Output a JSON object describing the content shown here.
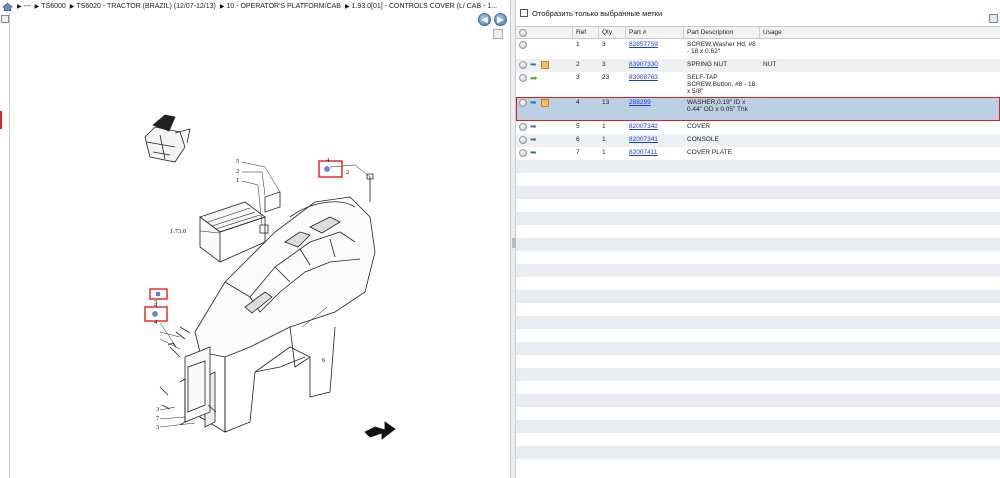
{
  "breadcrumb": {
    "items": [
      "---",
      "TS6000",
      "TS6020 - TRACTOR (BRAZIL) (12/07-12/13)",
      "10 - OPERATOR'S PLATFORM/CAB",
      "1.93.0[01] - CONTROLS COVER (L/ CAB - 1..."
    ]
  },
  "nav": {
    "back": "◀",
    "forward": "▶"
  },
  "filter": {
    "label": "Отобразить только выбранные метки"
  },
  "table": {
    "columns": [
      "Ref",
      "Qty",
      "Part #",
      "Part Description",
      "Usage"
    ],
    "rows": [
      {
        "ref": "1",
        "qty": "3",
        "part": "82857759",
        "desc": "SCREW,Washer Hd, #8 - 18 x 0.62\"",
        "usage": "",
        "icons": [
          "dot"
        ]
      },
      {
        "ref": "2",
        "qty": "3",
        "part": "83907330",
        "desc": "SPRING NUT",
        "usage": "NUT",
        "icons": [
          "dot",
          "link",
          "box"
        ]
      },
      {
        "ref": "3",
        "qty": "23",
        "part": "83908763",
        "desc": "SELF-TAP SCREW,Button, #8 - 18 x 5/8\"",
        "usage": "",
        "icons": [
          "dot",
          "arrow"
        ]
      },
      {
        "ref": "4",
        "qty": "13",
        "part": "288299",
        "desc": "WASHER,0.19\" ID x 0.44\" OD x 0.05\" Thk",
        "usage": "",
        "icons": [
          "dot",
          "link",
          "box"
        ]
      },
      {
        "ref": "5",
        "qty": "1",
        "part": "82007342",
        "desc": "COVER",
        "usage": "",
        "icons": [
          "dot",
          "link"
        ]
      },
      {
        "ref": "6",
        "qty": "1",
        "part": "82007341",
        "desc": "CONSOLE",
        "usage": "",
        "icons": [
          "dot",
          "link"
        ]
      },
      {
        "ref": "7",
        "qty": "1",
        "part": "82007411",
        "desc": "COVER PLATE",
        "usage": "",
        "icons": [
          "dot",
          "link"
        ]
      }
    ],
    "selected_row": 3
  },
  "drawing": {
    "labels": {
      "l5": "5",
      "l2": "2",
      "l1a": "1",
      "ref": "1.73.0",
      "l4a": "4",
      "l2b": "2",
      "l4b": "4",
      "l4c": "4",
      "l3a": "3",
      "l6": "6",
      "l3b": "3",
      "l7": "7",
      "l3c": "3"
    }
  },
  "colors": {
    "highlight": "#e02020",
    "selected_row": "#bdd0e3",
    "link": "#1a3cd6"
  }
}
